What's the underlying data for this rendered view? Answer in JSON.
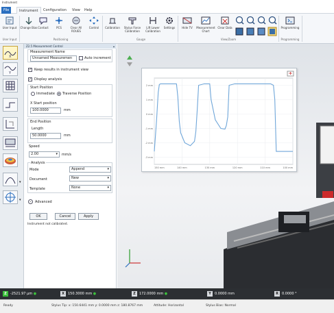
{
  "app": {
    "title": "Instrument"
  },
  "menu": {
    "tabs": [
      "File",
      "Instrument",
      "Configuration",
      "View",
      "Help"
    ]
  },
  "ribbon": {
    "buttons": [
      {
        "label": "User Input",
        "icon": "user-input-icon"
      },
      {
        "label": "Change Bias",
        "icon": "change-bias-icon"
      },
      {
        "label": "Contact",
        "icon": "contact-icon"
      },
      {
        "label": "PCS",
        "icon": "pcs-icon"
      },
      {
        "label": "Clear All ROUES",
        "icon": "clear-all-icon"
      },
      {
        "label": "Control",
        "icon": "control-icon"
      },
      {
        "label": "Calibration",
        "icon": "calibration-icon"
      },
      {
        "label": "Stylus Force Calibration",
        "icon": "stylus-force-icon"
      },
      {
        "label": "Lift Lower Calibration",
        "icon": "lift-lower-icon"
      },
      {
        "label": "Settings",
        "icon": "settings-icon"
      },
      {
        "label": "Hide TV",
        "icon": "hide-tv-icon"
      },
      {
        "label": "Measurement Chart",
        "icon": "measurement-chart-icon"
      },
      {
        "label": "Clear Data",
        "icon": "clear-data-icon"
      },
      {
        "label": "Programming",
        "icon": "programming-icon"
      }
    ],
    "groups": [
      "User Input",
      "Positioning",
      "Gauge",
      "View/Zoom",
      "Programming"
    ]
  },
  "panel": {
    "title": "Z2.5 Measurement Control",
    "measurement_name_label": "Measurement Name",
    "measurement_name_value": "Unnamed Measuremen",
    "auto_increment": "Auto increment",
    "keep_results": "Keep results in instrument view",
    "display_analysis": "Display analysis",
    "start_position_label": "Start Position",
    "immediate": "Immediate",
    "traverse_position": "Traverse Position",
    "x_start_label": "X Start position",
    "x_start_value": "100.0000",
    "x_start_unit": "mm",
    "end_position_label": "End Position",
    "length_label": "Length",
    "length_value": "50.0000",
    "length_unit": "mm",
    "speed_label": "Speed",
    "speed_value": "2.00",
    "speed_unit": "mm/s",
    "analysis_label": "Analysis",
    "mode_label": "Mode",
    "mode_value": "Append",
    "document_label": "Document",
    "document_value": "New",
    "template_label": "Template",
    "template_value": "None",
    "advanced": "Advanced",
    "ok": "OK",
    "cancel": "Cancel",
    "apply": "Apply",
    "status_msg": "Instrument not calibrated."
  },
  "chart_data": {
    "type": "line",
    "title": "",
    "xlabel": "",
    "ylabel": "",
    "x_ticks": [
      "150 mm",
      "140 mm",
      "130 mm",
      "120 mm",
      "110 mm",
      "100 mm"
    ],
    "y_ticks": [
      "2 mm",
      "1 mm",
      "0 mm",
      "-1 mm",
      "-2 mm",
      "-3 mm"
    ],
    "ylim": [
      -3.5,
      2.5
    ],
    "series": [
      {
        "x": [
          150,
          149.2,
          148.6,
          148.2,
          147.8,
          145,
          142,
          141.5,
          141,
          140.5,
          139,
          137,
          135.5,
          135,
          134.5,
          134,
          132,
          131,
          130.5,
          130,
          129.5,
          128,
          126,
          124.5,
          124,
          123.5,
          123,
          121,
          119.5,
          118.5,
          118,
          117.5,
          117,
          115,
          114,
          113,
          112,
          111,
          110,
          109,
          108,
          107,
          106.5,
          106,
          101,
          100
        ],
        "y": [
          -2.6,
          -0.5,
          1.5,
          2.05,
          2.1,
          2.1,
          2.1,
          1.2,
          -0.5,
          -1.3,
          -2.0,
          -2.2,
          -1.9,
          -1.2,
          0.3,
          2.0,
          2.1,
          2.1,
          2.1,
          2.1,
          1.0,
          -0.4,
          -1.0,
          -1.05,
          -0.8,
          -0.2,
          2.0,
          2.1,
          2.1,
          2.1,
          2.1,
          2.1,
          2.1,
          2.1,
          2.1,
          2.1,
          2.1,
          2.1,
          2.1,
          2.1,
          2.1,
          2.0,
          1.0,
          -2.6,
          -2.6,
          -2.6
        ]
      }
    ]
  },
  "coords": {
    "z_value": "-2521.97 μm",
    "x_label": "X",
    "x_value": "150.3000 mm",
    "z_label": "Z",
    "z_pos_value": "172.0000 mm",
    "y_label": "Y",
    "y_value": "0.0000 mm",
    "r_label": "R",
    "r_value": "0.0000 °"
  },
  "status": {
    "ready": "Ready",
    "stylus_tip": "Stylus Tip: x: 150.6441 mm y: 0.0000 mm z: 180.8767 mm",
    "attitude": "Attitude: Horizontal",
    "stylus_bias": "Stylus Bias: Normal"
  },
  "colors": {
    "accent": "#2b6fbf",
    "trace": "#6fa6d9",
    "coord_ok": "#3cc03c"
  }
}
